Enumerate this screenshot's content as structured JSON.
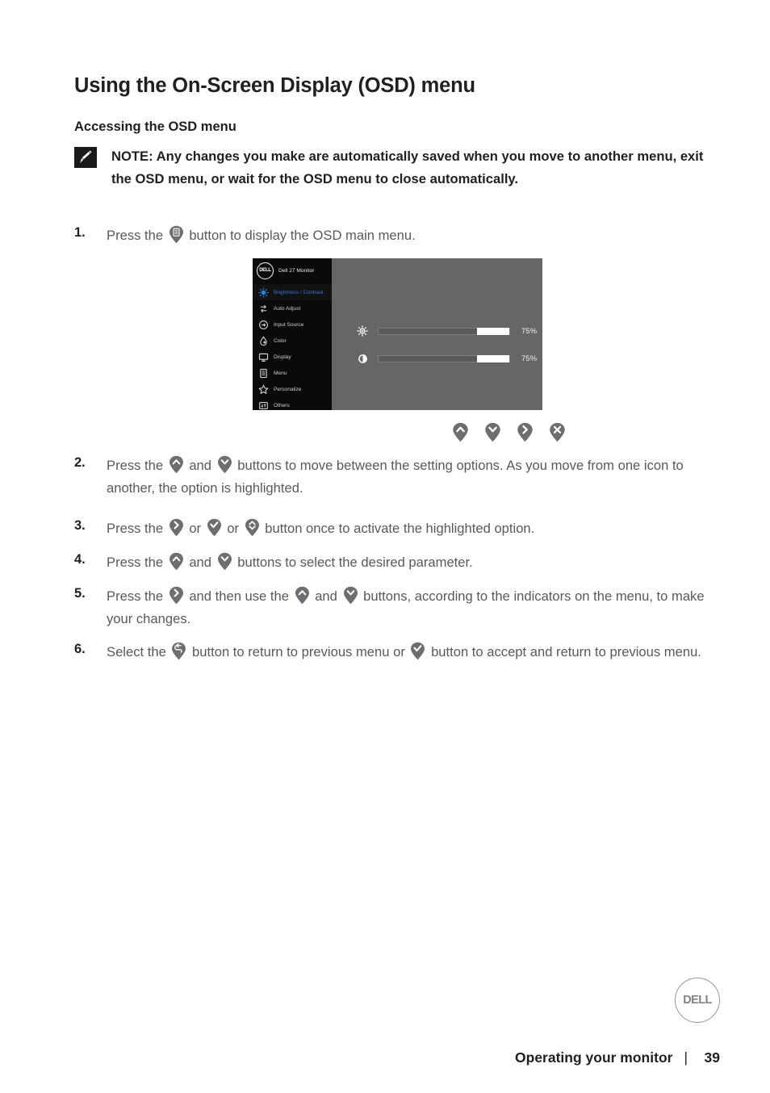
{
  "page": {
    "heading": "Using the On-Screen Display (OSD) menu",
    "subheading": "Accessing the OSD menu",
    "note": {
      "icon": "pencil-note-icon",
      "text": "NOTE: Any changes you make are automatically saved when you move to another menu, exit the OSD menu, or wait for the OSD menu to close automatically."
    }
  },
  "steps": [
    {
      "number": "1.",
      "parts": [
        {
          "type": "text",
          "value": "Press the "
        },
        {
          "type": "icon",
          "value": "menu-button-icon"
        },
        {
          "type": "text",
          "value": " button to display the OSD main menu."
        }
      ]
    },
    {
      "number": "2.",
      "parts": [
        {
          "type": "text",
          "value": "Press the "
        },
        {
          "type": "icon",
          "value": "up-button-icon"
        },
        {
          "type": "text",
          "value": " and "
        },
        {
          "type": "icon",
          "value": "down-button-icon"
        },
        {
          "type": "text",
          "value": " buttons to move between the setting options. As you move from one icon to another, the option is highlighted."
        }
      ]
    },
    {
      "number": "3.",
      "parts": [
        {
          "type": "text",
          "value": "Press the "
        },
        {
          "type": "icon",
          "value": "right-button-icon"
        },
        {
          "type": "text",
          "value": " or "
        },
        {
          "type": "icon",
          "value": "check-button-icon"
        },
        {
          "type": "text",
          "value": " or "
        },
        {
          "type": "icon",
          "value": "updown-button-icon"
        },
        {
          "type": "text",
          "value": " button once to activate the highlighted option."
        }
      ]
    },
    {
      "number": "4.",
      "parts": [
        {
          "type": "text",
          "value": "Press the "
        },
        {
          "type": "icon",
          "value": "up-button-icon"
        },
        {
          "type": "text",
          "value": " and "
        },
        {
          "type": "icon",
          "value": "down-button-icon"
        },
        {
          "type": "text",
          "value": " buttons to select the desired parameter."
        }
      ]
    },
    {
      "number": "5.",
      "parts": [
        {
          "type": "text",
          "value": "Press the "
        },
        {
          "type": "icon",
          "value": "right-button-icon"
        },
        {
          "type": "text",
          "value": " and then use the "
        },
        {
          "type": "icon",
          "value": "up-button-icon"
        },
        {
          "type": "text",
          "value": " and "
        },
        {
          "type": "icon",
          "value": "down-button-icon"
        },
        {
          "type": "text",
          "value": " buttons, according to the indicators on the menu, to make your changes."
        }
      ]
    },
    {
      "number": "6.",
      "parts": [
        {
          "type": "text",
          "value": "Select the "
        },
        {
          "type": "icon",
          "value": "back-button-icon"
        },
        {
          "type": "text",
          "value": " button to return to previous menu or "
        },
        {
          "type": "icon",
          "value": "check-button-icon"
        },
        {
          "type": "text",
          "value": " button to accept and return to previous menu."
        }
      ]
    }
  ],
  "osd": {
    "brand_logo": "DELL",
    "title": "Dell 27 Monitor",
    "menu_items": [
      {
        "label": "Brightness / Contrast",
        "icon": "brightness-icon",
        "selected": true
      },
      {
        "label": "Auto Adjust",
        "icon": "auto-adjust-icon",
        "selected": false
      },
      {
        "label": "Input Source",
        "icon": "input-source-icon",
        "selected": false
      },
      {
        "label": "Color",
        "icon": "color-icon",
        "selected": false
      },
      {
        "label": "Display",
        "icon": "display-icon",
        "selected": false
      },
      {
        "label": "Menu",
        "icon": "menu-icon",
        "selected": false
      },
      {
        "label": "Personalize",
        "icon": "personalize-star-icon",
        "selected": false
      },
      {
        "label": "Others",
        "icon": "others-icon",
        "selected": false
      }
    ],
    "sliders": [
      {
        "name": "brightness",
        "icon": "brightness-sun-icon",
        "value": "75%",
        "percent": 75
      },
      {
        "name": "contrast",
        "icon": "contrast-circle-icon",
        "value": "75%",
        "percent": 75
      }
    ],
    "colors": {
      "panel_bg": "#666666",
      "sidebar_bg": "#0a0a0a",
      "highlight": "#2f7fe0",
      "slider_fill": "#ffffff"
    }
  },
  "button_indicators": [
    {
      "icon": "up-button-icon",
      "name": "up"
    },
    {
      "icon": "down-button-icon",
      "name": "down"
    },
    {
      "icon": "right-button-icon",
      "name": "right"
    },
    {
      "icon": "close-button-icon",
      "name": "exit"
    }
  ],
  "footer": {
    "section": "Operating your monitor",
    "separator": "|",
    "page_number": "39",
    "badge_logo": "DELL"
  }
}
